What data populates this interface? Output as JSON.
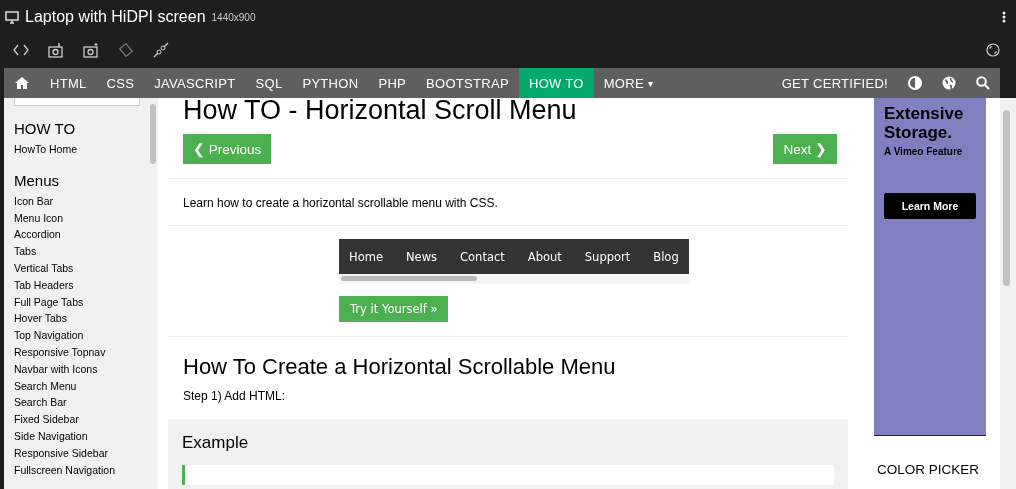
{
  "window": {
    "title": "Laptop with HiDPI screen",
    "resolution": "1440x900"
  },
  "navbar": {
    "items": [
      {
        "label": "HTML",
        "selected": false
      },
      {
        "label": "CSS",
        "selected": false
      },
      {
        "label": "JAVASCRIPT",
        "selected": false
      },
      {
        "label": "SQL",
        "selected": false
      },
      {
        "label": "PYTHON",
        "selected": false
      },
      {
        "label": "PHP",
        "selected": false
      },
      {
        "label": "BOOTSTRAP",
        "selected": false
      },
      {
        "label": "HOW TO",
        "selected": true
      },
      {
        "label": "MORE",
        "selected": false,
        "caret": "▾"
      }
    ],
    "certified": "GET CERTIFIED!"
  },
  "sidebar": {
    "sections": [
      {
        "heading": "HOW TO",
        "items": [
          "HowTo Home"
        ]
      },
      {
        "heading": "Menus",
        "items": [
          "Icon Bar",
          "Menu Icon",
          "Accordion",
          "Tabs",
          "Vertical Tabs",
          "Tab Headers",
          "Full Page Tabs",
          "Hover Tabs",
          "Top Navigation",
          "Responsive Topnav",
          "Navbar with Icons",
          "Search Menu",
          "Search Bar",
          "Fixed Sidebar",
          "Side Navigation",
          "Responsive Sidebar",
          "Fullscreen Navigation"
        ]
      }
    ]
  },
  "main": {
    "title": "How TO - Horizontal Scroll Menu",
    "previous": "❮ Previous",
    "next": "Next ❯",
    "intro": "Learn how to create a horizontal scrollable menu with CSS.",
    "demo_menu": [
      "Home",
      "News",
      "Contact",
      "About",
      "Support",
      "Blog"
    ],
    "try_button": "Try it Yourself »",
    "section_title": "How To Create a Horizontal Scrollable Menu",
    "step": "Step 1) Add HTML:",
    "example_title": "Example"
  },
  "ad": {
    "headline": "Extensive Storage.",
    "subline": "A Vimeo Feature",
    "button": "Learn More"
  },
  "color_picker": {
    "title": "COLOR PICKER"
  }
}
